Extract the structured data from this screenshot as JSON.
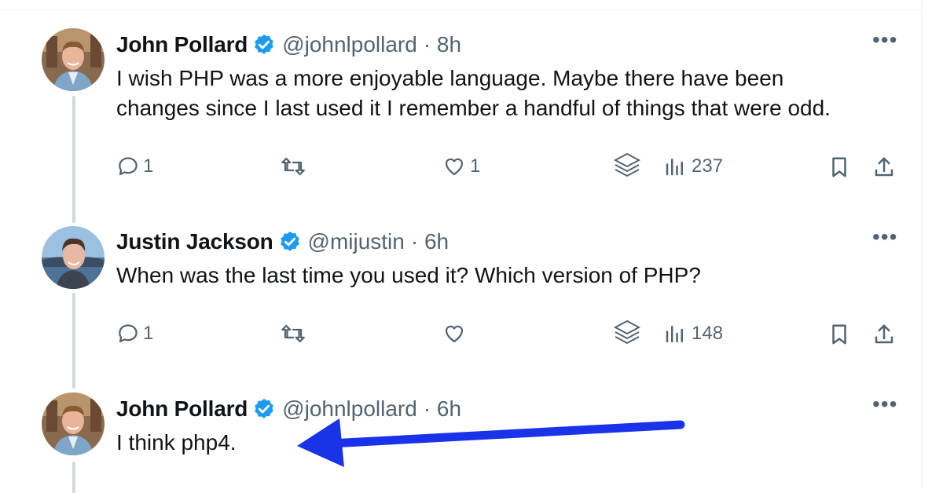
{
  "accent_color": "#1d9bf0",
  "annotation_color": "#1a33e8",
  "tweets": [
    {
      "name": "John Pollard",
      "handle": "@johnlpollard",
      "time": "· 8h",
      "text_lines": [
        "I wish PHP was a more enjoyable language. Maybe there have been",
        "changes since I last used it I remember a handful of things that were odd."
      ],
      "replies": "1",
      "retweets": "",
      "likes": "1",
      "views": "237"
    },
    {
      "name": "Justin Jackson",
      "handle": "@mijustin",
      "time": "· 6h",
      "text_lines": [
        "When was the last time you used it? Which version of PHP?"
      ],
      "replies": "1",
      "retweets": "",
      "likes": "",
      "views": "148"
    },
    {
      "name": "John Pollard",
      "handle": "@johnlpollard",
      "time": "· 6h",
      "text_lines": [
        "I think php4."
      ]
    }
  ],
  "icons": [
    "verified-badge-icon",
    "more-icon",
    "reply-icon",
    "retweet-icon",
    "like-icon",
    "grok-icon",
    "views-icon",
    "bookmark-icon",
    "share-icon"
  ]
}
